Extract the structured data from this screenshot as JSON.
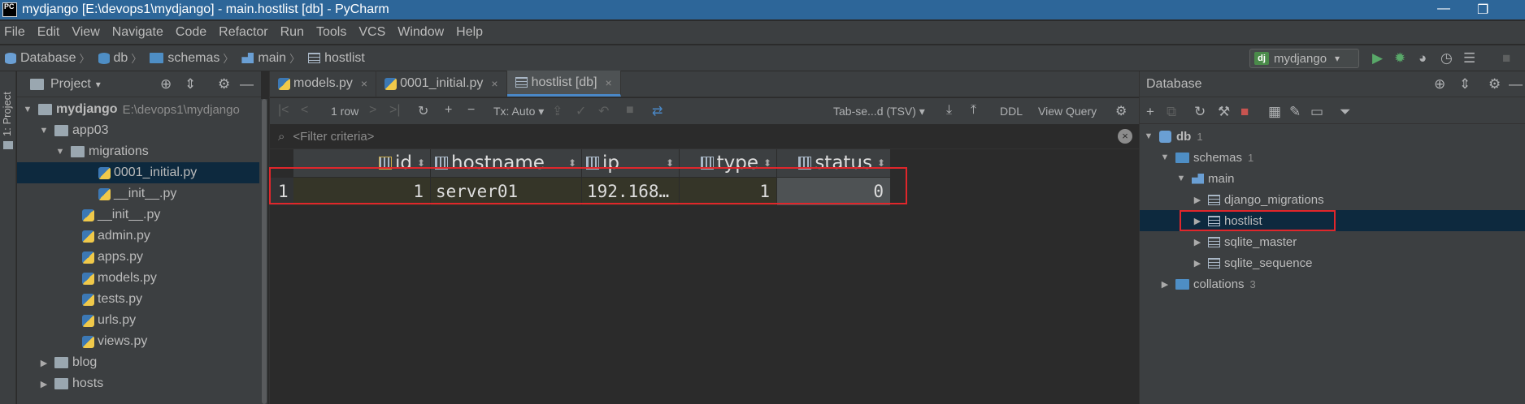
{
  "window": {
    "title": "mydjango [E:\\devops1\\mydjango] - main.hostlist [db] - PyCharm",
    "logo": "PC",
    "controls": [
      "minimize-icon",
      "restore-icon"
    ],
    "minimize_glyph": "—",
    "restore_glyph": "❐"
  },
  "menu": [
    "File",
    "Edit",
    "View",
    "Navigate",
    "Code",
    "Refactor",
    "Run",
    "Tools",
    "VCS",
    "Window",
    "Help"
  ],
  "breadcrumbs": [
    "Database",
    "db",
    "schemas",
    "main",
    "hostlist"
  ],
  "breadcrumb_sep": "〉",
  "run_config": {
    "badge": "dj",
    "name": "mydjango",
    "arrow": "▾"
  },
  "left_strip": {
    "label": "1: Project"
  },
  "project_panel": {
    "title": "Project",
    "title_arrow": "▾",
    "root": {
      "name": "mydjango",
      "path": "E:\\devops1\\mydjango"
    },
    "items": [
      {
        "label": "app03",
        "kind": "folder",
        "expanded": true
      },
      {
        "label": "migrations",
        "kind": "folder",
        "expanded": true
      },
      {
        "label": "0001_initial.py",
        "kind": "py",
        "selected": true
      },
      {
        "label": "__init__.py",
        "kind": "py"
      },
      {
        "label": "__init__.py",
        "kind": "py"
      },
      {
        "label": "admin.py",
        "kind": "py"
      },
      {
        "label": "apps.py",
        "kind": "py"
      },
      {
        "label": "models.py",
        "kind": "py"
      },
      {
        "label": "tests.py",
        "kind": "py"
      },
      {
        "label": "urls.py",
        "kind": "py"
      },
      {
        "label": "views.py",
        "kind": "py"
      },
      {
        "label": "blog",
        "kind": "folder",
        "expanded": false
      },
      {
        "label": "hosts",
        "kind": "folder",
        "expanded": false
      }
    ]
  },
  "editor_tabs": [
    {
      "label": "models.py",
      "kind": "py"
    },
    {
      "label": "0001_initial.py",
      "kind": "py"
    },
    {
      "label": "hostlist [db]",
      "kind": "table",
      "active": true
    }
  ],
  "tab_close": "×",
  "grid_toolbar": {
    "row_count": "1 row",
    "tx_mode": "Tx: Auto",
    "format": "Tab-se...d (TSV)",
    "ddl": "DDL",
    "view_query": "View Query"
  },
  "filter": {
    "placeholder": "<Filter criteria>"
  },
  "table": {
    "columns": [
      "id",
      "hostname",
      "ip",
      "type",
      "status"
    ],
    "rows": [
      {
        "row_num": "1",
        "id": "1",
        "hostname": "server01",
        "ip": "192.168…",
        "type": "1",
        "status": "0"
      }
    ]
  },
  "db_panel": {
    "title": "Database",
    "tree": [
      {
        "label": "db",
        "count": "1",
        "level": 0,
        "arrow": "▼",
        "icon": "datasource"
      },
      {
        "label": "schemas",
        "count": "1",
        "level": 1,
        "arrow": "▼",
        "icon": "folder"
      },
      {
        "label": "main",
        "count": "",
        "level": 2,
        "arrow": "▼",
        "icon": "schema"
      },
      {
        "label": "django_migrations",
        "count": "",
        "level": 3,
        "arrow": "▶",
        "icon": "table"
      },
      {
        "label": "hostlist",
        "count": "",
        "level": 3,
        "arrow": "▶",
        "icon": "table",
        "selected": true
      },
      {
        "label": "sqlite_master",
        "count": "",
        "level": 3,
        "arrow": "▶",
        "icon": "table"
      },
      {
        "label": "sqlite_sequence",
        "count": "",
        "level": 3,
        "arrow": "▶",
        "icon": "table"
      },
      {
        "label": "collations",
        "count": "3",
        "level": 1,
        "arrow": "▶",
        "icon": "folder"
      }
    ]
  },
  "colors": {
    "titlebar": "#2d6699",
    "panel": "#3c3f41",
    "editor": "#2b2b2b",
    "selection": "#0d293e",
    "highlight_annotation": "#e0262b",
    "run_green": "#59a869"
  }
}
